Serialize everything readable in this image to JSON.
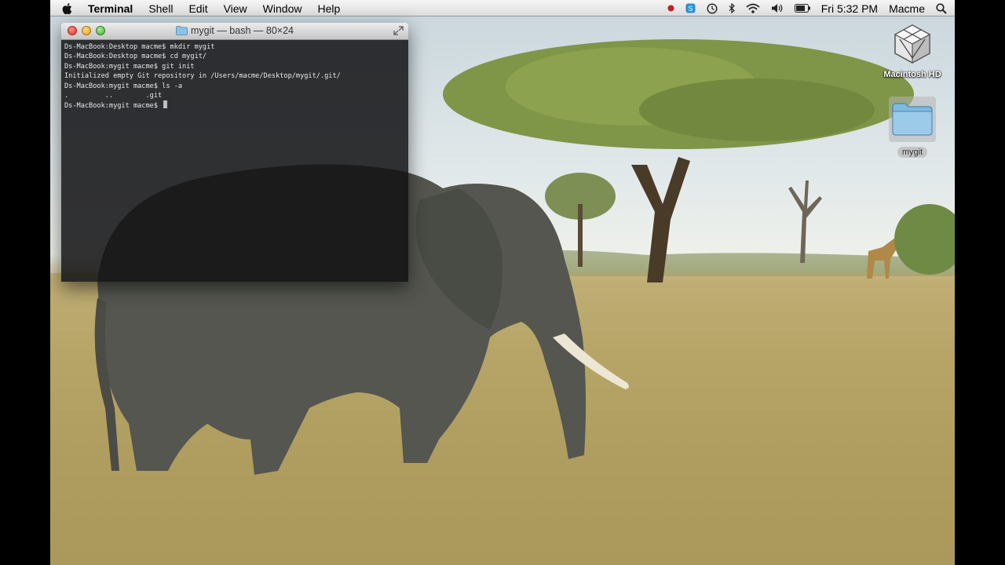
{
  "menubar": {
    "app_name": "Terminal",
    "menus": [
      "Shell",
      "Edit",
      "View",
      "Window",
      "Help"
    ],
    "clock": "Fri 5:32 PM",
    "user": "Macme"
  },
  "terminal": {
    "title": "mygit — bash — 80×24",
    "lines": [
      "Ds-MacBook:Desktop macme$ mkdir mygit",
      "Ds-MacBook:Desktop macme$ cd mygit/",
      "Ds-MacBook:mygit macme$ git init",
      "Initialized empty Git repository in /Users/macme/Desktop/mygit/.git/",
      "Ds-MacBook:mygit macme$ ls -a",
      ".         ..        .git",
      "Ds-MacBook:mygit macme$ "
    ]
  },
  "desktop": {
    "icons": [
      {
        "label": "Macintosh HD"
      },
      {
        "label": "mygit"
      }
    ]
  },
  "colors": {
    "terminal_bg": "#121214",
    "terminal_text": "#e8e8e8",
    "menubar_bg": "#e8e8e8",
    "recording_dot": "#c0202a",
    "folder_blue": "#7fb9dd"
  }
}
